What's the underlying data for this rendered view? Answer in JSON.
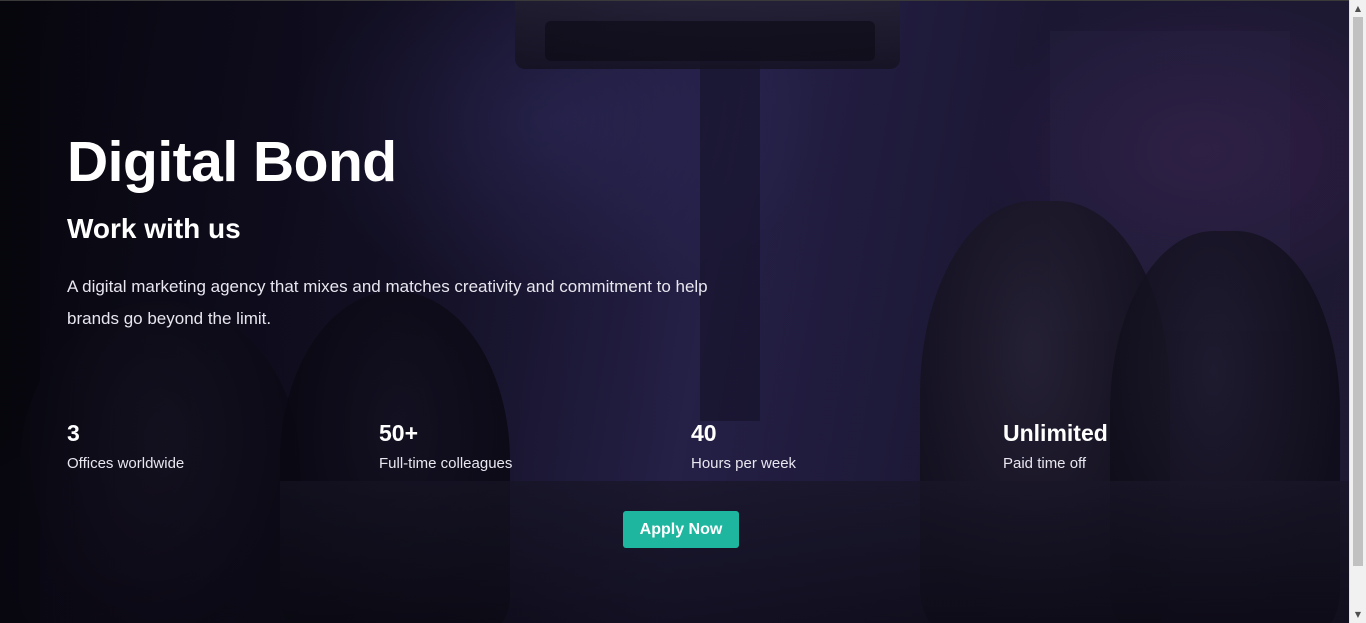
{
  "hero": {
    "title": "Digital Bond",
    "subtitle": "Work with us",
    "description": "A digital marketing agency that mixes and matches creativity and commitment to help brands go beyond the limit.",
    "apply_label": "Apply Now"
  },
  "stats": [
    {
      "value": "3",
      "label": "Offices worldwide"
    },
    {
      "value": "50+",
      "label": "Full-time colleagues"
    },
    {
      "value": "40",
      "label": "Hours per week"
    },
    {
      "value": "Unlimited",
      "label": "Paid time off"
    }
  ],
  "colors": {
    "accent": "#1fb6a0",
    "text": "#ffffff",
    "background_tint": "#2a2550"
  },
  "scrollbar": {
    "up_icon": "triangle-up",
    "down_icon": "triangle-down"
  }
}
